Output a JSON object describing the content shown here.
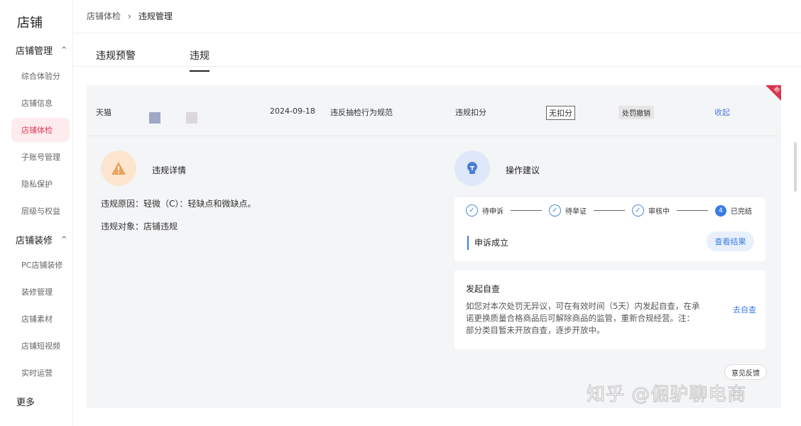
{
  "sidebar": {
    "title": "店铺",
    "group1": {
      "label": "店铺管理",
      "chevron": "^"
    },
    "items1": [
      {
        "label": "综合体验分"
      },
      {
        "label": "店铺信息"
      },
      {
        "label": "店铺体检"
      },
      {
        "label": "子账号管理"
      },
      {
        "label": "隐私保护"
      },
      {
        "label": "层级与权益"
      }
    ],
    "group2": {
      "label": "店铺装修",
      "chevron": "^"
    },
    "items2": [
      {
        "label": "PC店铺装修"
      },
      {
        "label": "装修管理"
      },
      {
        "label": "店铺素材"
      },
      {
        "label": "店铺短视频"
      },
      {
        "label": "实时运营"
      }
    ],
    "more": "更多"
  },
  "breadcrumb": {
    "parent": "店铺体检",
    "sep": "›",
    "current": "违规管理"
  },
  "tabs": [
    {
      "label": "违规预警"
    },
    {
      "label": "违规"
    }
  ],
  "violation": {
    "platform": "天猫",
    "date": "2024-09-18",
    "type": "违反抽检行为规范",
    "category": "违规扣分",
    "points": "无扣分",
    "penalty": "处罚撤销",
    "collapse": "收起",
    "new_badge": "新"
  },
  "detail": {
    "title": "违规详情",
    "reason": "违规原因：轻微（C）：轻缺点和微缺点。",
    "target": "违规对象：店铺违规"
  },
  "suggestion": {
    "title": "操作建议",
    "steps": [
      {
        "label": "待申诉"
      },
      {
        "label": "待举证"
      },
      {
        "label": "审核中"
      },
      {
        "num": "4",
        "label": "已完结"
      }
    ],
    "status": "申诉成立",
    "view_button": "查看结果",
    "self_check": {
      "title": "发起自查",
      "desc": "如您对本次处罚无异议，可在有效时间（5天）内发起自查，在承诺更换质量合格商品后可解除商品的监管，重新合规经营。注：部分类目暂未开放自查，逐步开放中。",
      "link": "去自查"
    },
    "feedback": "意见反馈"
  },
  "watermark": "知乎 @倔驴聊电商",
  "colors": {
    "accent_red": "#e0405a",
    "link_blue": "#3b7be8",
    "warn_orange": "#f0a05a"
  }
}
